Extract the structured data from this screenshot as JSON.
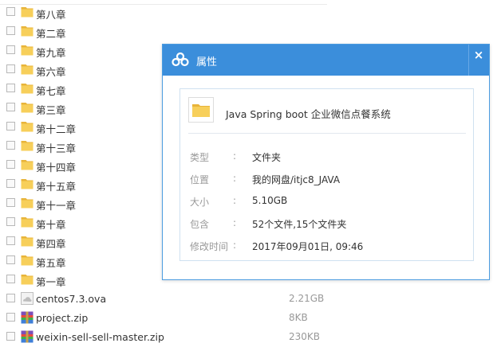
{
  "files": [
    {
      "name": "第八章",
      "type": "folder",
      "size": ""
    },
    {
      "name": "第二章",
      "type": "folder",
      "size": ""
    },
    {
      "name": "第九章",
      "type": "folder",
      "size": ""
    },
    {
      "name": "第六章",
      "type": "folder",
      "size": ""
    },
    {
      "name": "第七章",
      "type": "folder",
      "size": ""
    },
    {
      "name": "第三章",
      "type": "folder",
      "size": ""
    },
    {
      "name": "第十二章",
      "type": "folder",
      "size": ""
    },
    {
      "name": "第十三章",
      "type": "folder",
      "size": ""
    },
    {
      "name": "第十四章",
      "type": "folder",
      "size": ""
    },
    {
      "name": "第十五章",
      "type": "folder",
      "size": ""
    },
    {
      "name": "第十一章",
      "type": "folder",
      "size": ""
    },
    {
      "name": "第十章",
      "type": "folder",
      "size": ""
    },
    {
      "name": "第四章",
      "type": "folder",
      "size": ""
    },
    {
      "name": "第五章",
      "type": "folder",
      "size": ""
    },
    {
      "name": "第一章",
      "type": "folder",
      "size": ""
    },
    {
      "name": "centos7.3.ova",
      "type": "disk-image",
      "size": "2.21GB"
    },
    {
      "name": "project.zip",
      "type": "zip",
      "size": "8KB"
    },
    {
      "name": "weixin-sell-sell-master.zip",
      "type": "zip",
      "size": "230KB"
    }
  ],
  "dialog": {
    "title": "属性",
    "close_glyph": "×",
    "folder_name": "Java Spring boot 企业微信点餐系统",
    "properties": [
      {
        "label": "类型",
        "value": "文件夹"
      },
      {
        "label": "位置",
        "value": "我的网盘/itjc8_JAVA"
      },
      {
        "label": "大小",
        "value": "5.10GB"
      },
      {
        "label": "包含",
        "value": "52个文件,15个文件夹"
      },
      {
        "label": "修改时间",
        "value": "2017年09月01日, 09:46"
      }
    ]
  },
  "colors": {
    "accent": "#3b8edb",
    "folder": "#f5c242",
    "muted_text": "#999999"
  }
}
